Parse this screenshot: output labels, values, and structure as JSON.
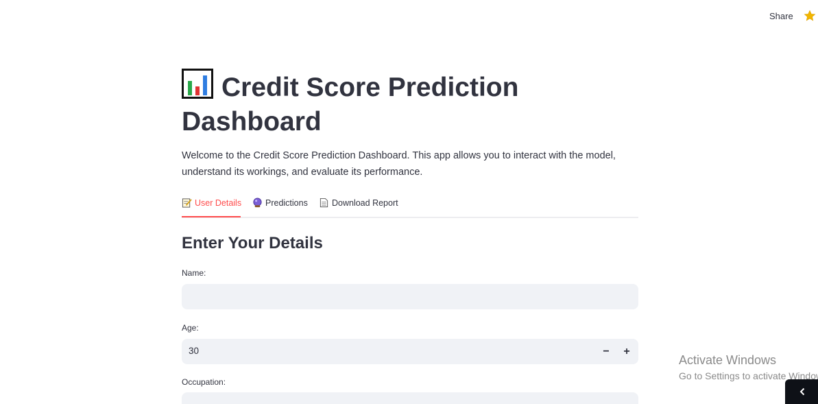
{
  "topbar": {
    "share_label": "Share",
    "star_icon": "star-icon"
  },
  "header": {
    "title": "Credit Score Prediction Dashboard",
    "title_icon": "bar-chart-icon",
    "description": "Welcome to the Credit Score Prediction Dashboard. This app allows you to interact with the model, understand its workings, and evaluate its performance."
  },
  "tabs": [
    {
      "label": "User Details",
      "icon": "memo-icon",
      "active": true
    },
    {
      "label": "Predictions",
      "icon": "crystal-ball-icon",
      "active": false
    },
    {
      "label": "Download Report",
      "icon": "document-icon",
      "active": false
    }
  ],
  "form": {
    "title": "Enter Your Details",
    "name": {
      "label": "Name:",
      "value": ""
    },
    "age": {
      "label": "Age:",
      "value": "30",
      "minus": "−",
      "plus": "+"
    },
    "occupation": {
      "label": "Occupation:",
      "value": ""
    }
  },
  "os_watermark": {
    "line1": "Activate Windows",
    "line2": "Go to Settings to activate Windows."
  },
  "colors": {
    "accent": "#ff4b4b",
    "input_bg": "#f0f2f6",
    "text": "#31333f"
  }
}
